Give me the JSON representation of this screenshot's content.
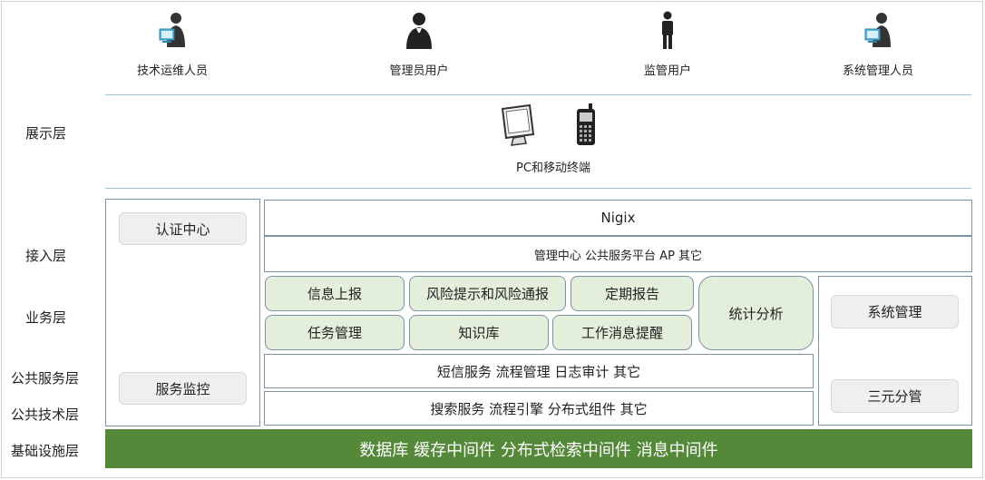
{
  "users": [
    {
      "label": "技术运维人员",
      "icon": "tech-operator-icon"
    },
    {
      "label": "管理员用户",
      "icon": "admin-user-icon"
    },
    {
      "label": "监管用户",
      "icon": "supervisor-user-icon"
    },
    {
      "label": "系统管理人员",
      "icon": "system-admin-icon"
    }
  ],
  "layers": {
    "display": "展示层",
    "access": "接入层",
    "business": "业务层",
    "public_service": "公共服务层",
    "public_tech": "公共技术层",
    "infra": "基础设施层"
  },
  "terminals": {
    "label": "PC和移动终端"
  },
  "left_column": {
    "auth": "认证中心",
    "monitor": "服务监控"
  },
  "access": {
    "nigix": "Nigix",
    "gateway": "管理中心   公共服务平台  AP  其它"
  },
  "business": {
    "row1": [
      "信息上报",
      "风险提示和风险通报",
      "定期报告"
    ],
    "row2": [
      "任务管理",
      "知识库",
      "工作消息提醒"
    ],
    "stats": "统计分析"
  },
  "public_service": {
    "text": "短信服务  流程管理  日志审计  其它"
  },
  "public_tech": {
    "text": "搜索服务  流程引擎  分布式组件  其它"
  },
  "right_column": {
    "system": "系统管理",
    "triple": "三元分管"
  },
  "infrastructure": {
    "text": "数据库   缓存中间件    分布式检索中间件   消息中间件"
  },
  "colors": {
    "accent_green": "#55893a",
    "light_green": "#e3efdb",
    "border": "#7c93a6",
    "divider": "#a9c3d6"
  }
}
